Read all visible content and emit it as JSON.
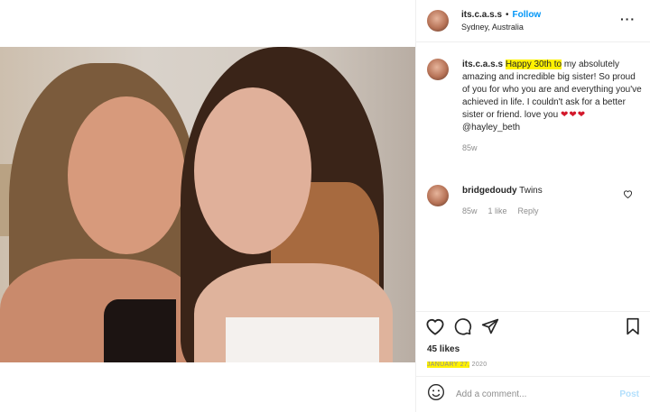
{
  "post": {
    "username": "its.c.a.s.s",
    "follow_label": "Follow",
    "separator": "•",
    "location": "Sydney, Australia",
    "more_label": "···"
  },
  "caption": {
    "username": "its.c.a.s.s",
    "highlight": "Happy 30th to",
    "text": " my absolutely amazing and incredible big sister! So proud of you for who you are and everything you've achieved in life. I couldn't ask for a better sister or friend. love you ",
    "hearts": "❤❤❤",
    "mention": "@hayley_beth",
    "age": "85w"
  },
  "reply": {
    "username": "bridgedoudy",
    "text": "Twins",
    "age": "85w",
    "likes": "1 like",
    "reply_label": "Reply"
  },
  "engagement": {
    "likes": "45 likes",
    "date_highlight": "JANUARY 27,",
    "date_rest": " 2020"
  },
  "comment_box": {
    "placeholder": "Add a comment...",
    "post_label": "Post"
  },
  "icons": [
    "heart-icon",
    "comment-icon",
    "share-icon",
    "bookmark-icon",
    "smiley-icon",
    "more-icon"
  ],
  "colors": {
    "follow": "#0095f6",
    "highlight": "#fff200",
    "heart": "#d3182b",
    "muted": "#8e8e8e"
  }
}
